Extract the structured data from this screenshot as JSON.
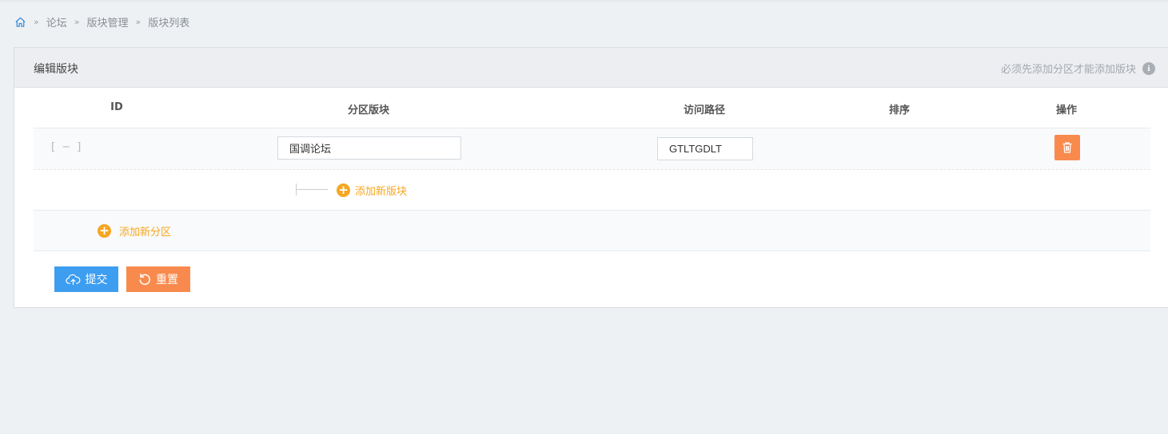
{
  "breadcrumb": {
    "items": [
      "论坛",
      "版块管理",
      "版块列表"
    ],
    "separator": "»"
  },
  "panel": {
    "title": "编辑版块",
    "hint": "必须先添加分区才能添加版块",
    "info_glyph": "i"
  },
  "table": {
    "columns": [
      "ID",
      "分区版块",
      "访问路径",
      "排序",
      "操作"
    ],
    "rows": [
      {
        "toggle": "[ − ]",
        "name": "国调论坛",
        "path": "GTLTGDLT",
        "sort": ""
      }
    ]
  },
  "add_board_label": "添加新版块",
  "add_section_label": "添加新分区",
  "buttons": {
    "submit": "提交",
    "reset": "重置"
  },
  "colors": {
    "primary": "#3d9df0",
    "warning": "#f98a4e",
    "accent_orange": "#f5a623",
    "background": "#eef1f4"
  },
  "icons": [
    "home-icon",
    "info-icon",
    "trash-icon",
    "plus-circle-icon",
    "cloud-upload-icon",
    "refresh-icon"
  ]
}
